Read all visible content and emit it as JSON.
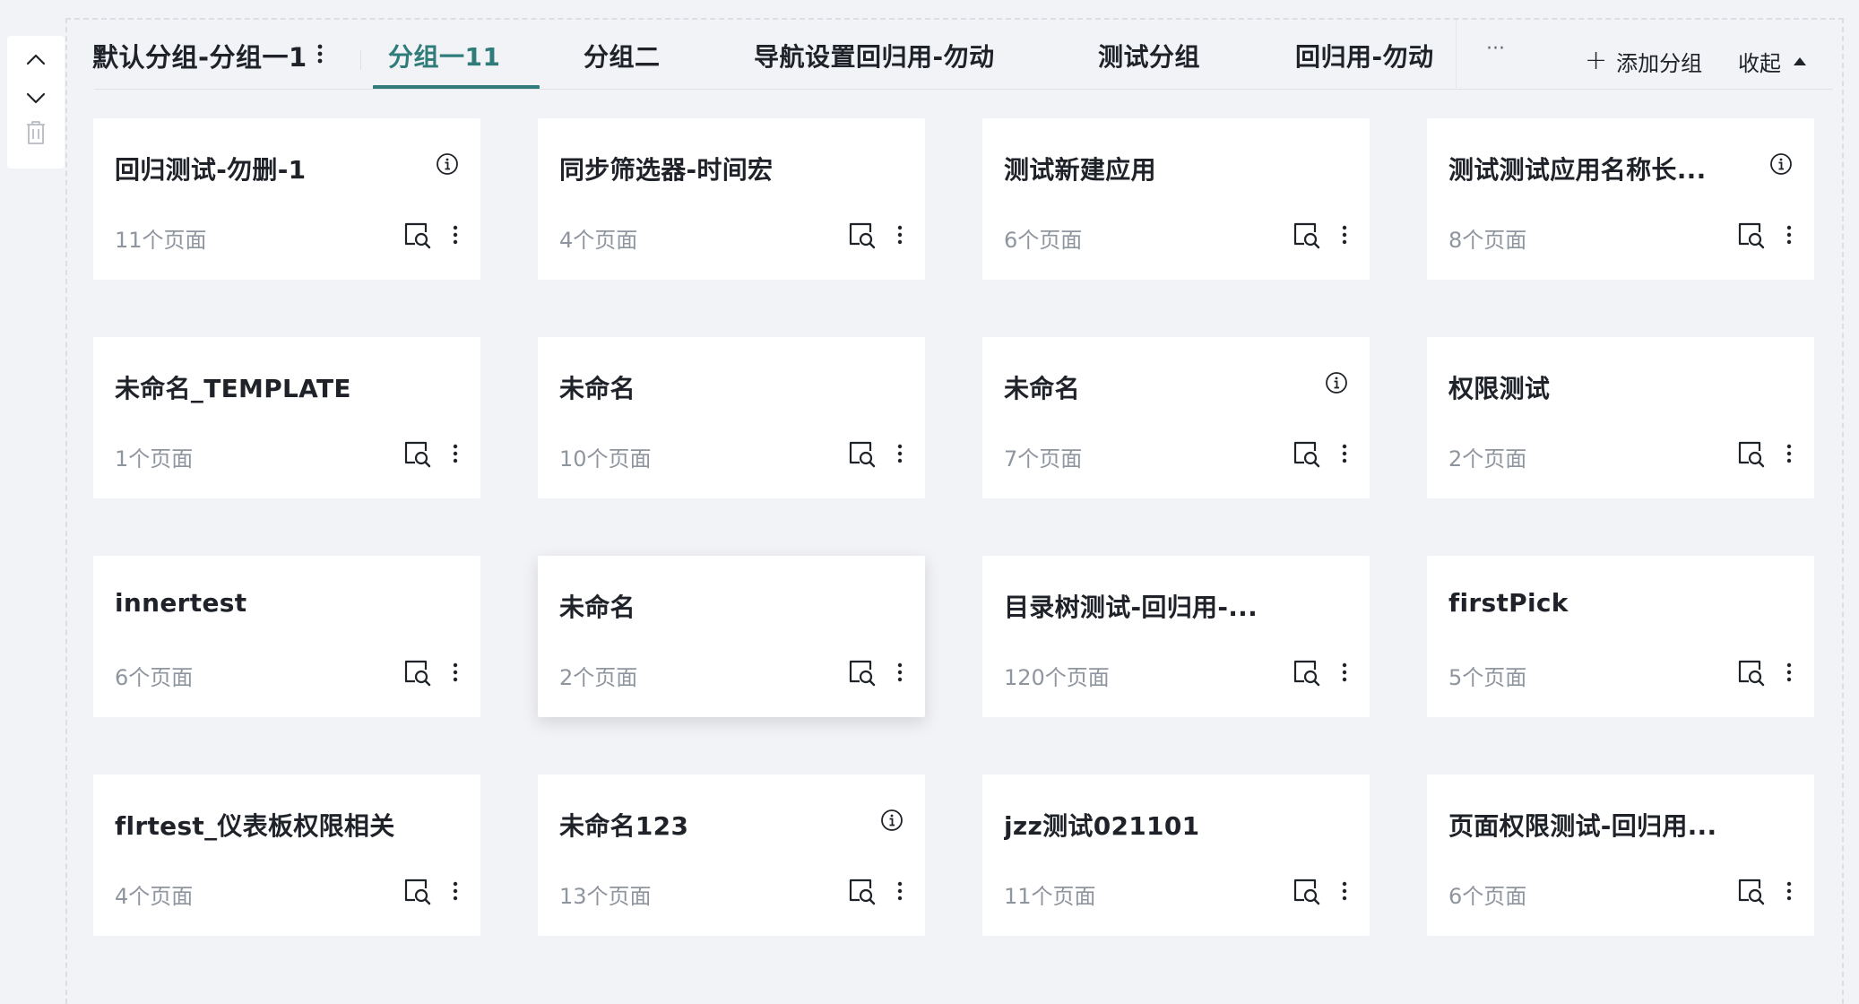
{
  "header": {
    "group_title": "默认分组-分组一1",
    "tabs": [
      {
        "label": "分组一11",
        "active": true
      },
      {
        "label": "分组二",
        "active": false
      },
      {
        "label": "导航设置回归用-勿动",
        "active": false
      },
      {
        "label": "测试分组",
        "active": false
      },
      {
        "label": "回归用-勿动",
        "active": false
      }
    ],
    "more_label": "···",
    "add_group_label": "添加分组",
    "collapse_label": "收起"
  },
  "colors": {
    "accent": "#2f7c7a",
    "background": "#f2f3f6",
    "card": "#ffffff",
    "muted_text": "#8f959e"
  },
  "icons": {
    "side_toolbar": [
      "chevron-up-icon",
      "chevron-down-icon",
      "trash-icon"
    ],
    "card": [
      "info-icon",
      "preview-icon",
      "more-vertical-icon"
    ]
  },
  "cards": [
    {
      "title": "回归测试-勿删-1",
      "count": "11个页面",
      "info": true
    },
    {
      "title": "同步筛选器-时间宏",
      "count": "4个页面",
      "info": false
    },
    {
      "title": "测试新建应用",
      "count": "6个页面",
      "info": false
    },
    {
      "title": "测试测试应用名称长...",
      "count": "8个页面",
      "info": true
    },
    {
      "title": "未命名_TEMPLATE",
      "count": "1个页面",
      "info": false
    },
    {
      "title": "未命名",
      "count": "10个页面",
      "info": false
    },
    {
      "title": "未命名",
      "count": "7个页面",
      "info": true
    },
    {
      "title": "权限测试",
      "count": "2个页面",
      "info": false
    },
    {
      "title": "innertest",
      "count": "6个页面",
      "info": false
    },
    {
      "title": "未命名",
      "count": "2个页面",
      "info": false,
      "hover": true
    },
    {
      "title": "目录树测试-回归用-...",
      "count": "120个页面",
      "info": false
    },
    {
      "title": "firstPick",
      "count": "5个页面",
      "info": false
    },
    {
      "title": "flrtest_仪表板权限相关",
      "count": "4个页面",
      "info": false
    },
    {
      "title": "未命名123",
      "count": "13个页面",
      "info": true
    },
    {
      "title": "jzz测试021101",
      "count": "11个页面",
      "info": false
    },
    {
      "title": "页面权限测试-回归用...",
      "count": "6个页面",
      "info": false
    }
  ]
}
